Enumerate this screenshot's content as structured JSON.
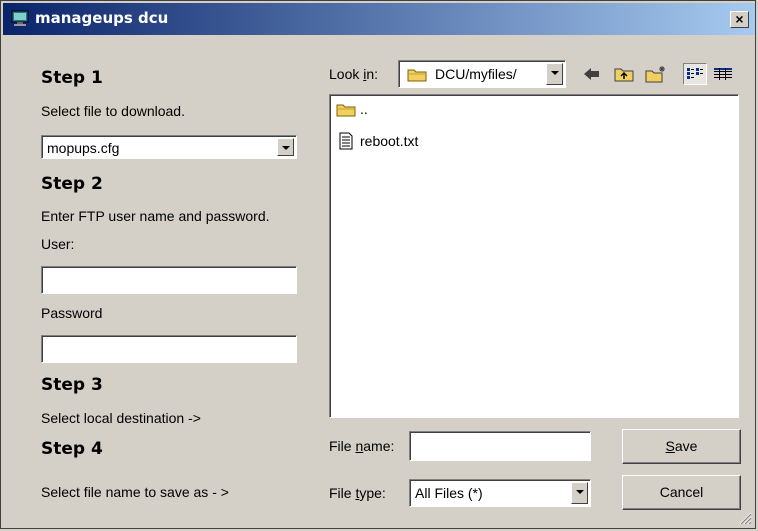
{
  "window": {
    "title": "manageups dcu",
    "close_symbol": "×"
  },
  "steps": [
    {
      "title": "Step 1",
      "desc": "Select file to download."
    },
    {
      "title": "Step 2",
      "desc": "Enter FTP user name and password."
    },
    {
      "title": "Step 3",
      "desc": "Select local destination ->"
    },
    {
      "title": "Step 4",
      "desc": "Select file name to save as - >"
    }
  ],
  "download_select": {
    "value": "mopups.cfg"
  },
  "user": {
    "label": "User:",
    "value": ""
  },
  "password": {
    "label": "Password",
    "value": ""
  },
  "look_in": {
    "label_prefix": "Look ",
    "label_hotkey": "i",
    "label_suffix": "n:",
    "value": "DCU/myfiles/"
  },
  "files": [
    {
      "name": "..",
      "icon": "folder-icon"
    },
    {
      "name": "reboot.txt",
      "icon": "text-file-icon"
    }
  ],
  "file_name": {
    "label_prefix": "File ",
    "label_hotkey": "n",
    "label_suffix": "ame:",
    "value": ""
  },
  "file_type": {
    "label_prefix": "File ",
    "label_hotkey": "t",
    "label_suffix": "ype:",
    "value": "All Files (*)"
  },
  "buttons": {
    "save_hotkey": "S",
    "save_rest": "ave",
    "cancel": "Cancel"
  },
  "colors": {
    "title_start": "#0a246a",
    "title_end": "#a6caf0",
    "face": "#d4d0c8"
  }
}
